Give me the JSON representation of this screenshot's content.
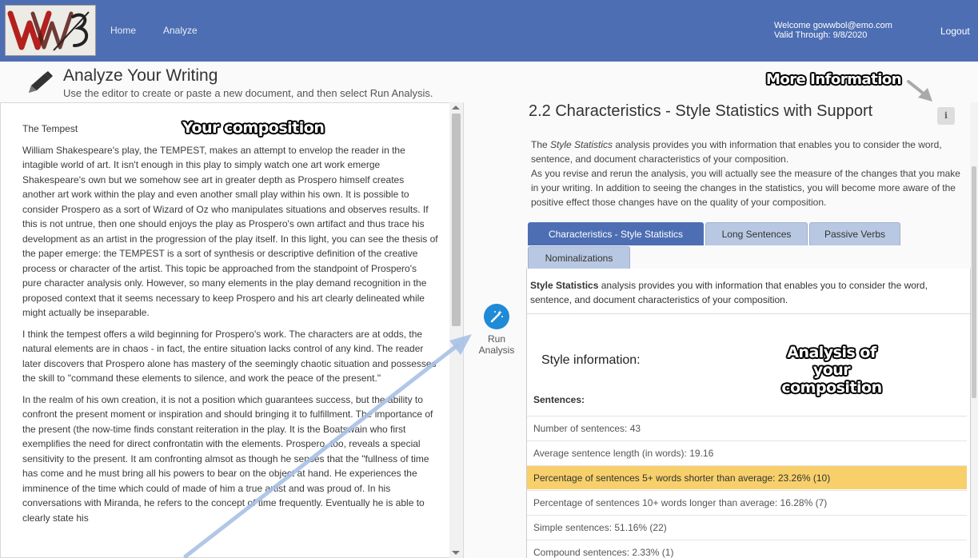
{
  "nav": {
    "logo_alt": "WW3 logo",
    "links": [
      "Home",
      "Analyze"
    ],
    "welcome_line": "Welcome gowwbol@emo.com",
    "valid_line": "Valid Through: 9/8/2020",
    "logout": "Logout"
  },
  "header": {
    "title": "Analyze Your Writing",
    "subtitle": "Use the editor to create or paste a new document, and then select Run Analysis."
  },
  "editor": {
    "doc_title": "The Tempest",
    "paragraphs": [
      "William Shakespeare's play, the TEMPEST, makes an attempt to envelop the reader in the intagible world of art. It isn't enough in this play to simply watch one art work emerge Shakespeare's own but we somehow see art in greater depth as Prospero himself creates another art work within the play and even another small play within his own. It is possible to consider Prospero as a sort of Wizard of Oz who manipulates situations and observes results. If this is not untrue, then one should enjoys the play as Prospero's own artifact and thus trace his development as an artist in the progression of the play itself. In this light, you can see the thesis of the paper emerge: the TEMPEST is a sort of synthesis or descriptive definition of the creative process or character of the artist. This topic be approached from the standpoint of Prospero's pure character analysis only. However, so many elements in the play demand recognition in the proposed context that it seems necessary to keep Prospero and his art clearly delineated while might actually be inseparable.",
      "I think the tempest offers a wild beginning for Prospero's work. The characters are at odds, the natural elements are in chaos - in fact, the entire situation lacks control of any kind. The reader later discovers that Prospero alone has mastery of the seemingly chaotic situation and possesses the skill to \"command these elements to silence, and work the peace of the present.\"",
      "In the realm of his own creation, it is not a position which guarantees success, but the ability to confront the present moment or inspiration and should bringing it to fulfillment. The importance of the present (the now-time finds constant reiteration in the play. It is the Boatswain who first exemplifies the need for direct confrontatin with the elements. Prospero, too, reveals a special sensitivity to the present. It am confronting almsot as though he senses that the \"fullness of time has come and he must bring all his powers to bear on the object at hand. He experiences the imminence of the time which could of made of him a true artist and was proud of. In his conversations with Miranda, he refers to the concept of time frequently. Eventually he is able to clearly state his"
    ]
  },
  "run_button": {
    "line1": "Run",
    "line2": "Analysis"
  },
  "annotations": {
    "composition": "Your composition",
    "more_info": "More Information",
    "analysis_line1": "Analysis of your",
    "analysis_line2": "composition"
  },
  "analysis": {
    "title": "2.2 Characteristics - Style Statistics with Support",
    "info_icon": "ℹ",
    "intro_pre": "The ",
    "intro_em": "Style Statistics",
    "intro_post": " analysis provides you with information that enables you to consider the word, sentence, and document characteristics of your composition.",
    "intro_2": "As you revise and rerun the analysis, you will actually see the measure of the changes that you make in your writing. In addition to seeing the changes in the statistics, you will become more aware of the positive effect those changes have on the quality of your composition.",
    "tabs": [
      "Characteristics - Style Statistics",
      "Long Sentences",
      "Passive Verbs",
      "Nominalizations"
    ],
    "tab_desc_bold": "Style Statistics",
    "tab_desc_rest": " analysis provides you with information that enables you to consider the word, sentence, and document characteristics of your composition.",
    "style_info": "Style information:",
    "sentences_header": "Sentences:",
    "stats": [
      "Number of sentences: 43",
      "Average sentence length (in words): 19.16",
      "Percentage of sentences 5+ words shorter than average: 23.26% (10)",
      "Percentage of sentences 10+ words longer than average: 16.28% (7)",
      "Simple sentences: 51.16% (22)",
      "Compound sentences: 2.33% (1)"
    ]
  },
  "colors": {
    "navbar": "#4d6eb3",
    "highlight_row": "#f8d06b",
    "run_button": "#1f8ad6"
  }
}
